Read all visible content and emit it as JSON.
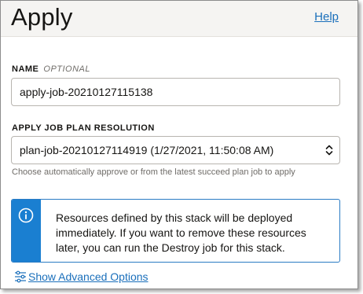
{
  "header": {
    "title": "Apply",
    "help_label": "Help"
  },
  "form": {
    "name": {
      "label": "NAME",
      "optional_label": "OPTIONAL",
      "value": "apply-job-20210127115138"
    },
    "plan_resolution": {
      "label": "APPLY JOB PLAN RESOLUTION",
      "selected": "plan-job-20210127114919 (1/27/2021, 11:50:08 AM)",
      "hint": "Choose automatically approve or from the latest succeed plan job to apply"
    }
  },
  "info": {
    "icon": "info-icon",
    "message": "Resources defined by this stack will be deployed immediately. If you want to remove these resources later, you can run the Destroy job for this stack.",
    "accent_color": "#1a7fd1"
  },
  "advanced": {
    "icon": "sliders-icon",
    "label": "Show Advanced Options"
  },
  "colors": {
    "link": "#1a6fbb",
    "header_bg": "#f5f4f2"
  }
}
